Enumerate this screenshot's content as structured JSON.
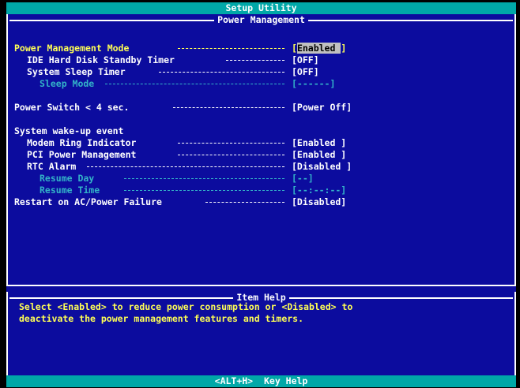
{
  "title": "Setup Utility",
  "section_title": "Power Management",
  "items": [
    {
      "label": "Power Management Mode",
      "value_open": "[",
      "value_selected": "Enabled ",
      "value_close": "]",
      "color": "yellow",
      "state": "selected"
    },
    {
      "label": "IDE Hard Disk Standby Timer",
      "value": "[OFF]",
      "color": "white"
    },
    {
      "label": "System Sleep Timer",
      "value": "[OFF]",
      "color": "white"
    },
    {
      "label": "Sleep Mode",
      "value": "[------]",
      "color": "cyan",
      "state": "disabled"
    },
    {
      "label": "Power Switch < 4 sec.",
      "value": "[Power Off]",
      "color": "white"
    },
    {
      "label": "System wake-up event",
      "color": "white"
    },
    {
      "label": "Modem Ring Indicator",
      "value": "[Enabled ]",
      "color": "white"
    },
    {
      "label": "PCI Power Management",
      "value": "[Enabled ]",
      "color": "white"
    },
    {
      "label": "RTC Alarm",
      "value": "[Disabled ]",
      "color": "white"
    },
    {
      "label": "Resume Day",
      "value": "[--]",
      "color": "cyan",
      "state": "disabled"
    },
    {
      "label": "Resume Time",
      "value": "[--:--:--]",
      "color": "cyan",
      "state": "disabled"
    },
    {
      "label": "Restart on AC/Power Failure",
      "value": "[Disabled]",
      "color": "white"
    }
  ],
  "help": {
    "title": "Item Help",
    "line1": "Select <Enabled> to reduce power consumption or <Disabled> to",
    "line2": "deactivate the power management features and timers."
  },
  "footer": {
    "key": "<ALT+H>",
    "label": "Key Help"
  },
  "colors": {
    "background": "#0c0c9e",
    "bar": "#00a8a8",
    "highlight_text": "#ffff55",
    "normal_text": "#ffffff",
    "disabled_text": "#33b3c8",
    "selection": "#c0c0c0"
  }
}
